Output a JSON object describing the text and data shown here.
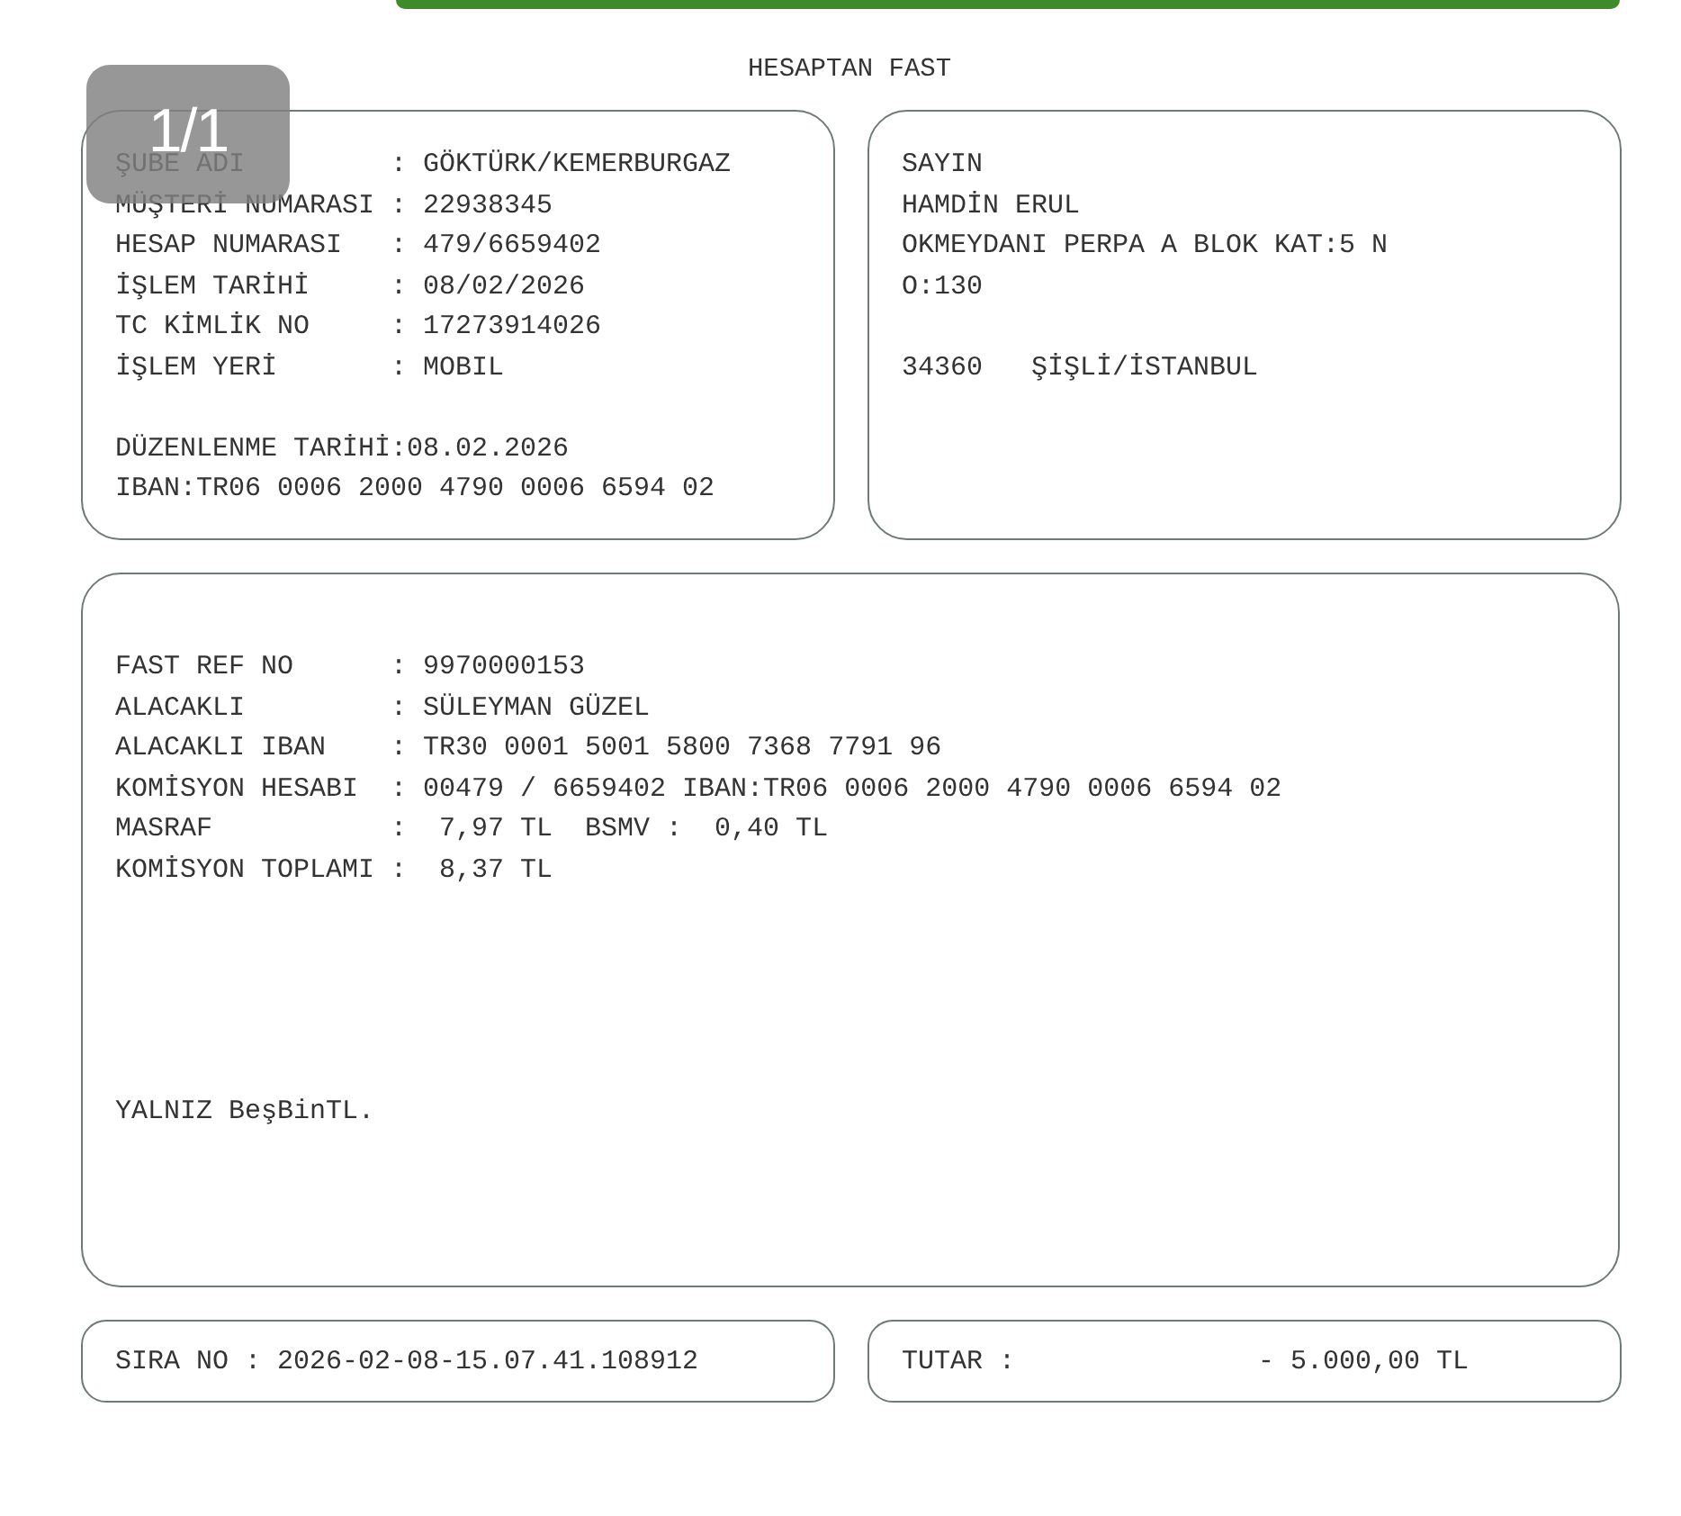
{
  "page_badge": "1/1",
  "document": {
    "title": "HESAPTAN FAST",
    "account_box": {
      "lines": [
        "ŞUBE ADI         : GÖKTÜRK/KEMERBURGAZ",
        "MÜŞTERİ NUMARASI : 22938345",
        "HESAP NUMARASI   : 479/6659402",
        "İŞLEM TARİHİ     : 08/02/2026",
        "TC KİMLİK NO     : 17273914026",
        "İŞLEM YERİ       : MOBIL"
      ],
      "footer_lines": [
        "DÜZENLENME TARİHİ:08.02.2026",
        "IBAN:TR06 0006 2000 4790 0006 6594 02"
      ]
    },
    "address_box": {
      "lines": [
        "SAYIN",
        "HAMDİN ERUL",
        "OKMEYDANI PERPA A BLOK KAT:5 N",
        "O:130"
      ],
      "footer_lines": [
        "34360   ŞİŞLİ/İSTANBUL"
      ]
    },
    "transfer_box": {
      "lines": [
        "FAST REF NO      : 9970000153",
        "ALACAKLI         : SÜLEYMAN GÜZEL",
        "ALACAKLI IBAN    : TR30 0001 5001 5800 7368 7791 96",
        "KOMİSYON HESABI  : 00479 / 6659402 IBAN:TR06 0006 2000 4790 0006 6594 02",
        "MASRAF           :  7,97 TL  BSMV :  0,40 TL",
        "KOMİSYON TOPLAMI :  8,37 TL"
      ],
      "amount_in_words": "YALNIZ BeşBinTL."
    },
    "sequence": "SIRA NO : 2026-02-08-15.07.41.108912",
    "amount_label": "TUTAR :",
    "amount": "- 5.000,00 TL"
  }
}
